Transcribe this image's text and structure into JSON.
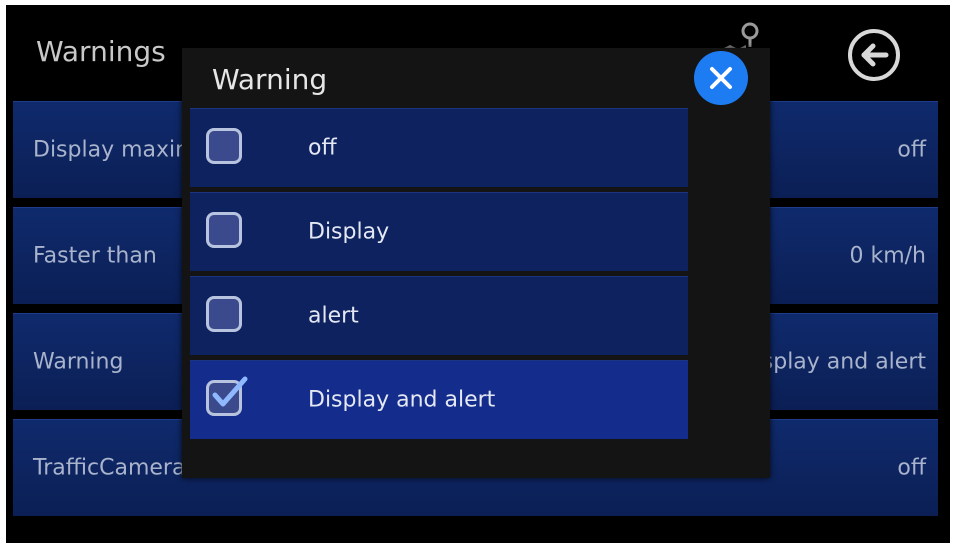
{
  "screen": {
    "title": "Warnings"
  },
  "settings": [
    {
      "label": "Display maximum speed",
      "value": "off"
    },
    {
      "label": "Faster than",
      "value": "0 km/h"
    },
    {
      "label": "Warning",
      "value": "Display and alert"
    },
    {
      "label": "TrafficCamera",
      "value": "off"
    }
  ],
  "dialog": {
    "title": "Warning",
    "options": [
      {
        "label": "off",
        "checked": false
      },
      {
        "label": "Display",
        "checked": false
      },
      {
        "label": "alert",
        "checked": false
      },
      {
        "label": "Display and alert",
        "checked": true
      }
    ]
  },
  "icons": {
    "map": "map-pin-icon",
    "back": "back-arrow-icon",
    "close": "close-icon",
    "check": "checkmark-icon"
  },
  "colors": {
    "background": "#000000",
    "row": "#0f2a6c",
    "option": "#0f2260",
    "option_selected": "#142d8c",
    "accent": "#1e7cf2",
    "text": "#a9b3cc"
  }
}
